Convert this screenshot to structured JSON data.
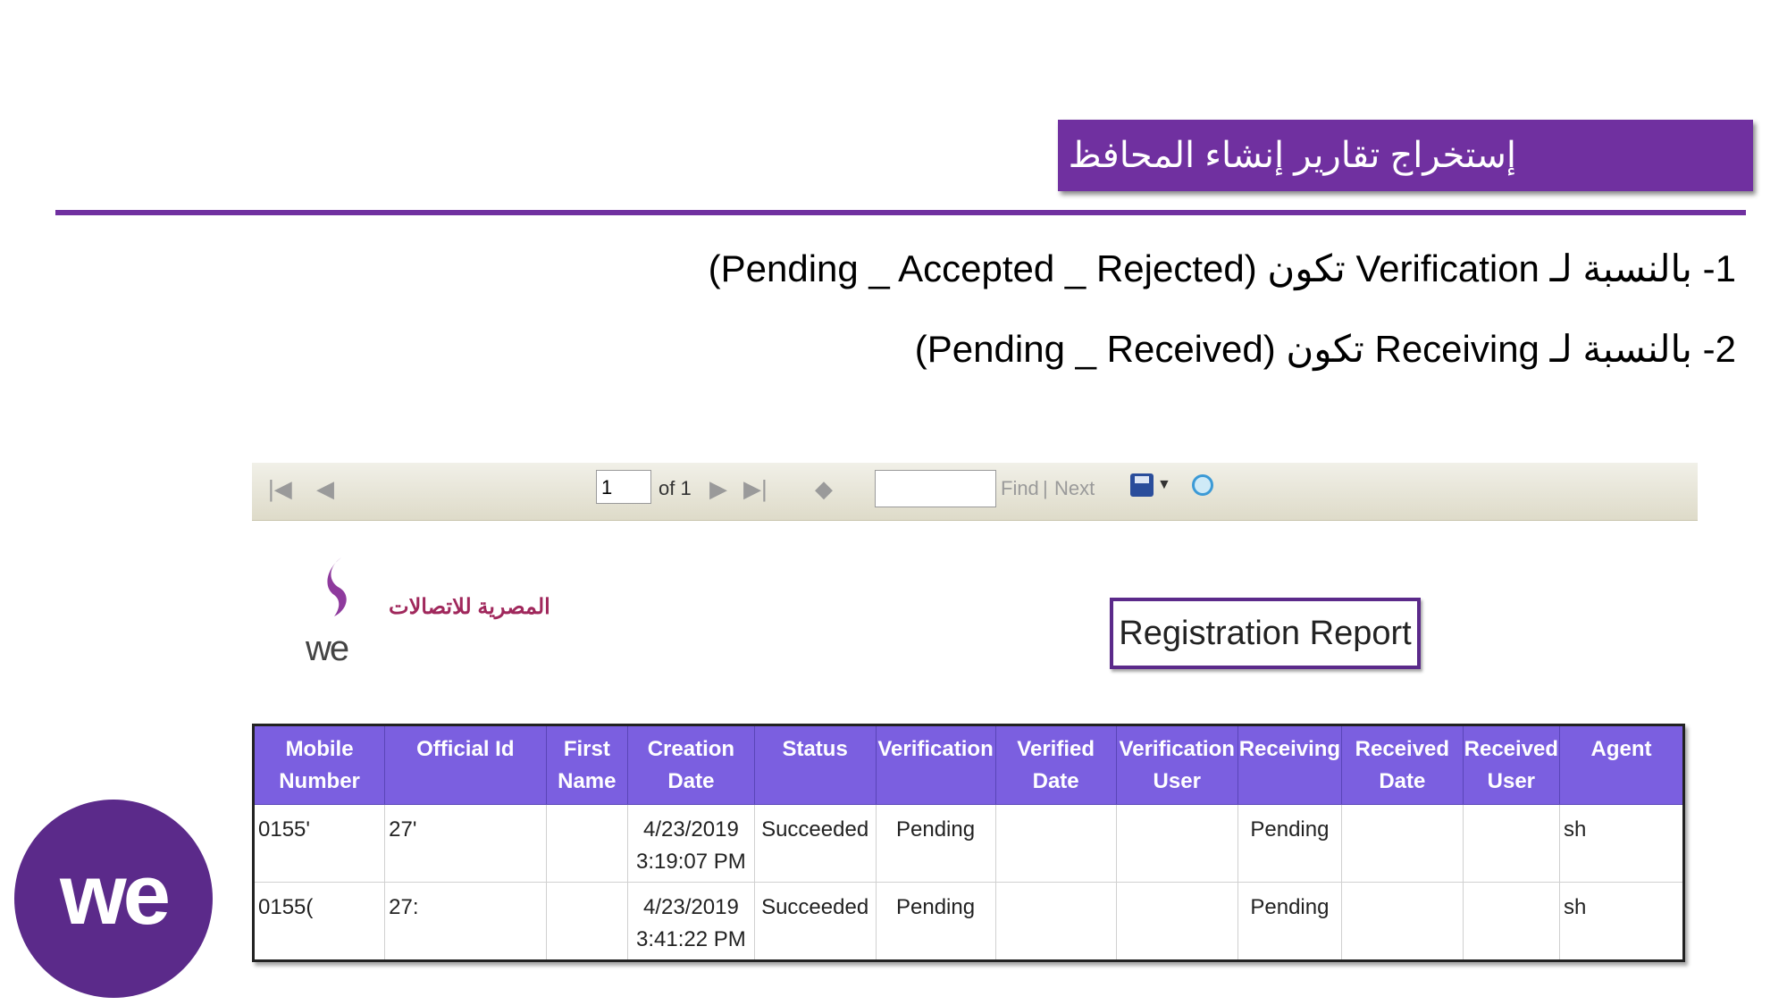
{
  "slide": {
    "title": "إستخراج تقارير إنشاء المحافظ",
    "bullet_1": "1- بالنسبة لـ Verification تكون (Pending _ Accepted _ Rejected)",
    "bullet_2": "2- بالنسبة لـ Receiving تكون (Pending _ Received)"
  },
  "toolbar": {
    "page_value": "1",
    "of_label": "of 1",
    "find_label": "Find",
    "separator": "|",
    "next_label": "Next",
    "icons": [
      "first-page-icon",
      "prev-page-icon",
      "next-page-icon",
      "last-page-icon",
      "zoom-icon",
      "export-icon",
      "refresh-icon"
    ]
  },
  "logo": {
    "we_text": "we",
    "arabic_text": "المصرية للاتصالات"
  },
  "report": {
    "title": "Registration Report",
    "header_color": "#7b5fe0",
    "columns": [
      [
        "Mobile",
        "Number"
      ],
      [
        "Official Id",
        ""
      ],
      [
        "First",
        "Name"
      ],
      [
        "Creation",
        "Date"
      ],
      [
        "Status",
        ""
      ],
      [
        "Verification",
        ""
      ],
      [
        "Verified",
        "Date"
      ],
      [
        "Verification",
        "User"
      ],
      [
        "Receiving",
        ""
      ],
      [
        "Received",
        "Date"
      ],
      [
        "Received",
        "User"
      ],
      [
        "Agent",
        ""
      ]
    ],
    "rows": [
      {
        "mobile": "0155'",
        "official_id": "27'",
        "first_name": "",
        "creation_date": "4/23/2019",
        "creation_time": "3:19:07 PM",
        "status": "Succeeded",
        "verification": "Pending",
        "verified_date": "",
        "verification_user": "",
        "receiving": "Pending",
        "received_date": "",
        "received_user": "",
        "agent": "sh"
      },
      {
        "mobile": "0155(",
        "official_id": "27:",
        "first_name": "",
        "creation_date": "4/23/2019",
        "creation_time": "3:41:22 PM",
        "status": "Succeeded",
        "verification": "Pending",
        "verified_date": "",
        "verification_user": "",
        "receiving": "Pending",
        "received_date": "",
        "received_user": "",
        "agent": "sh"
      }
    ]
  },
  "brand": {
    "circle_text": "we",
    "purple": "#7030a0"
  }
}
